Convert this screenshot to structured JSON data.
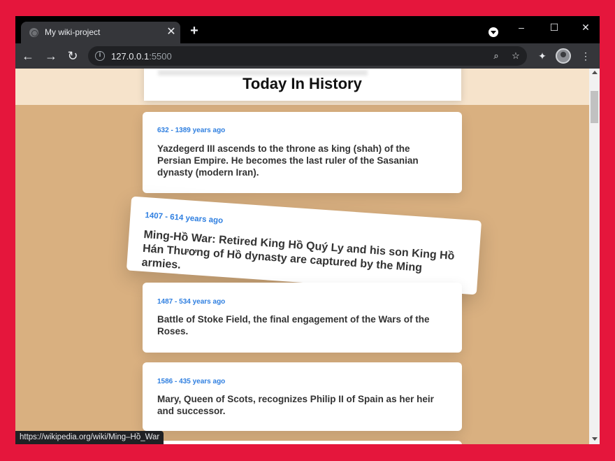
{
  "browser": {
    "tab_title": "My wiki-project",
    "tab_close_glyph": "✕",
    "new_tab_glyph": "+",
    "url_host": "127.0.0.1",
    "url_port": ":5500",
    "status_url": "https://wikipedia.org/wiki/Ming–Hồ_War"
  },
  "page": {
    "title": "Today In History",
    "background_color": "#d9b080",
    "header_color": "#f6e3cb",
    "accent_color": "#2f7fe0"
  },
  "events": [
    {
      "date": "632 - 1389 years ago",
      "text": "Yazdegerd III ascends to the throne as king (shah) of the Persian Empire. He becomes the last ruler of the Sasanian dynasty (modern Iran)."
    },
    {
      "date": "1407 - 614 years ago",
      "text": "Ming-Hồ War: Retired King Hồ Quý Ly and his son King Hồ Hán Thương of Hồ dynasty are captured by the Ming armies."
    },
    {
      "date": "1487 - 534 years ago",
      "text": "Battle of Stoke Field, the final engagement of the Wars of the Roses."
    },
    {
      "date": "1586 - 435 years ago",
      "text": "Mary, Queen of Scots, recognizes Philip II of Spain as her heir and successor."
    }
  ]
}
